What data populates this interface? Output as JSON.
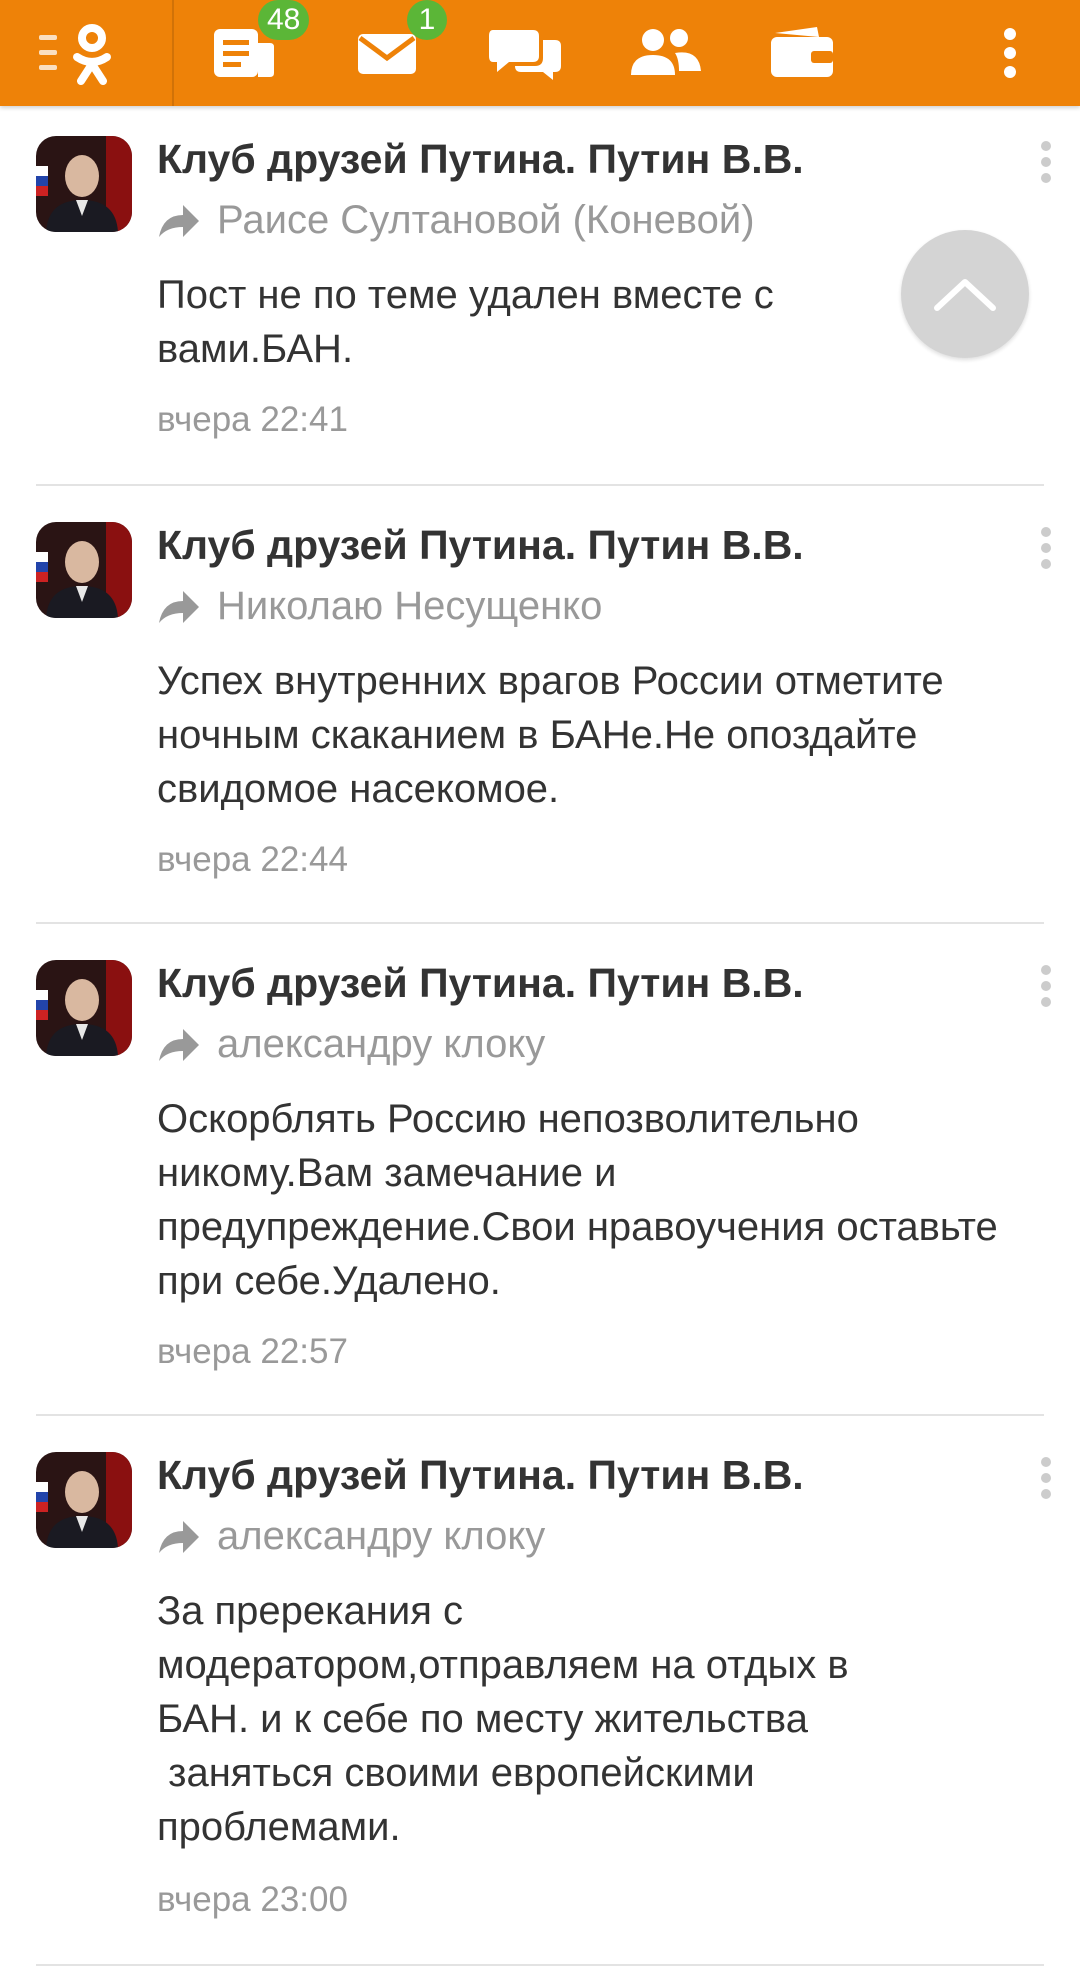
{
  "toolbar": {
    "feed_badge": "48",
    "messages_badge": "1",
    "accent": "#ee8208",
    "badge_color": "#5bb637"
  },
  "feed": {
    "items": [
      {
        "author": "Клуб друзей Путина. Путин В.В.",
        "target": "Раисе Султановой (Коневой)",
        "message": "Пост не по теме удален вместе с вами.БАН.",
        "time": "вчера 22:41"
      },
      {
        "author": "Клуб друзей Путина. Путин В.В.",
        "target": "Николаю Несущенко",
        "message": "Успех внутренних врагов России отметите ночным скаканием в БАНе.Не опоздайте свидомое насекомое.",
        "time": "вчера 22:44"
      },
      {
        "author": "Клуб друзей Путина. Путин В.В.",
        "target": "александру клоку",
        "message": "Оскорблять Россию непозволительно никому.Вам замечание и предупреждение.Свои нравоучения оставьте при себе.Удалено.",
        "time": "вчера 22:57"
      },
      {
        "author": "Клуб друзей Путина. Путин В.В.",
        "target": "александру клоку",
        "message": "За пререкания с\nмодератором,отправляем на отдых в\nБАН. и к себе по месту жительства\n заняться своими европейскими\nпроблемами.",
        "time": "вчера 23:00"
      }
    ]
  }
}
